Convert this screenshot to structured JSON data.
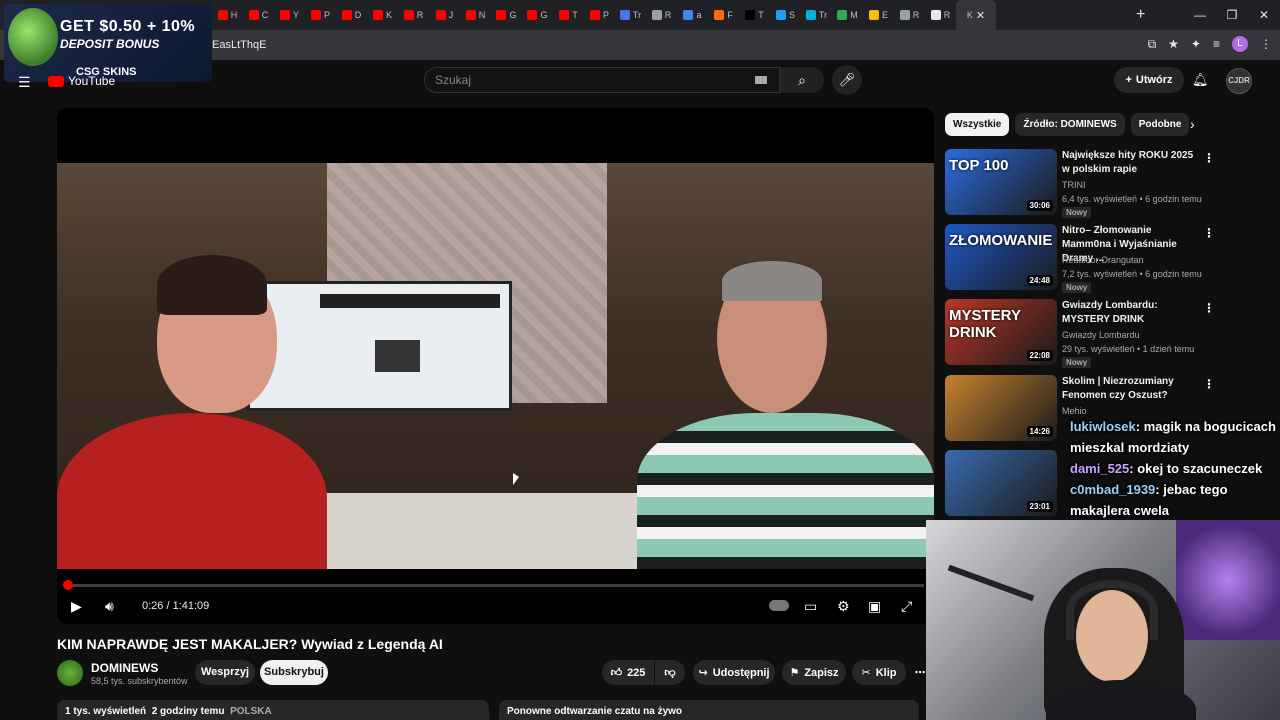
{
  "browser": {
    "tabs": [
      {
        "letter": "H",
        "color": "#ff0000"
      },
      {
        "letter": "C",
        "color": "#ff0000"
      },
      {
        "letter": "Y",
        "color": "#ff0000"
      },
      {
        "letter": "P",
        "color": "#ff0000"
      },
      {
        "letter": "D",
        "color": "#ff0000"
      },
      {
        "letter": "K",
        "color": "#ff0000"
      },
      {
        "letter": "R",
        "color": "#ff0000"
      },
      {
        "letter": "J",
        "color": "#ff0000"
      },
      {
        "letter": "N",
        "color": "#ff0000"
      },
      {
        "letter": "G",
        "color": "#ff0000"
      },
      {
        "letter": "G",
        "color": "#ff0000"
      },
      {
        "letter": "T",
        "color": "#ff0000"
      },
      {
        "letter": "P",
        "color": "#ff0000"
      },
      {
        "letter": "Tr",
        "color": "#4a73e8"
      },
      {
        "letter": "R",
        "color": "#9aa0a6"
      },
      {
        "letter": "a",
        "color": "#4285f4"
      },
      {
        "letter": "F",
        "color": "#ff6d00"
      },
      {
        "letter": "T",
        "color": "#000000"
      },
      {
        "letter": "S",
        "color": "#1da1f2"
      },
      {
        "letter": "Tr",
        "color": "#00b4d8"
      },
      {
        "letter": "M",
        "color": "#34a853"
      },
      {
        "letter": "E",
        "color": "#fbbc04"
      },
      {
        "letter": "R",
        "color": "#9aa0a6"
      },
      {
        "letter": "R",
        "color": "#e8eaed"
      }
    ],
    "active_tab_letter": "K",
    "url": "EasLtThqE"
  },
  "ad": {
    "line1": "GET $0.50 + 10%",
    "line2": "DEPOSIT BONUS",
    "brand": "CSG SKINS"
  },
  "header": {
    "logo_text": "YouTube",
    "search_placeholder": "Szukaj",
    "create_label": "Utwórz",
    "avatar_text": "CJDR"
  },
  "player": {
    "time": "0:26 / 1:41:09",
    "progress_fraction": 0.0043
  },
  "video": {
    "title": "KIM NAPRAWDĘ JEST MAKALJER? Wywiad z Legendą AI",
    "channel": "DOMINEWS",
    "subscribers": "58,5 tys. subskrybentów",
    "support_label": "Wesprzyj",
    "subscribe_label": "Subskrybuj",
    "likes": "225",
    "share_label": "Udostępnij",
    "save_label": "Zapisz",
    "clip_label": "Klip",
    "views": "1 tys. wyświetleń",
    "age": "2 godziny temu",
    "country": "POLSKA",
    "replay_label": "Ponowne odtwarzanie czatu na żywo"
  },
  "chips": [
    "Wszystkie",
    "Źródło: DOMINEWS",
    "Podobne"
  ],
  "recommendations": [
    {
      "title": "Największe hity ROKU 2025 w polskim rapie",
      "channel": "TRINI",
      "meta": "6,4 tys. wyświetleń • 6 godzin temu",
      "badge": "Nowy",
      "duration": "30:06",
      "thumb_text": "TOP 100",
      "thumb_color": "#2d6cdf"
    },
    {
      "title": "Nitro– Złomowanie Mamm0na i Wyjaśnianie Dramy ...",
      "channel": "Redaktor Orangutan",
      "meta": "7,2 tys. wyświetleń • 6 godzin temu",
      "badge": "Nowy",
      "duration": "24:48",
      "thumb_text": "ZŁOMOWANIE",
      "thumb_color": "#1f57c8"
    },
    {
      "title": "Gwiazdy Lombardu: MYSTERY DRINK",
      "channel": "Gwiazdy Lombardu",
      "meta": "29 tys. wyświetleń • 1 dzień temu",
      "badge": "Nowy",
      "duration": "22:08",
      "thumb_text": "MYSTERY DRINK",
      "thumb_color": "#b8362a"
    },
    {
      "title": "Skolim | Niezrozumiany Fenomen czy Oszust?",
      "channel": "Mehio",
      "meta": "",
      "badge": "",
      "duration": "14:26",
      "thumb_text": "",
      "thumb_color": "#c7832e"
    },
    {
      "title": "",
      "channel": "",
      "meta": "",
      "badge": "",
      "duration": "23:01",
      "thumb_text": "",
      "thumb_color": "#3a6bb0"
    }
  ],
  "chat": [
    {
      "user": "lukiwlosek",
      "message": ": magik na bogucicach mieszkal mordziaty"
    },
    {
      "user": "dami_525",
      "message": ": okej to szacuneczek"
    },
    {
      "user": "c0mbad_1939",
      "message": ": jebac tego makajlera cwela"
    }
  ]
}
